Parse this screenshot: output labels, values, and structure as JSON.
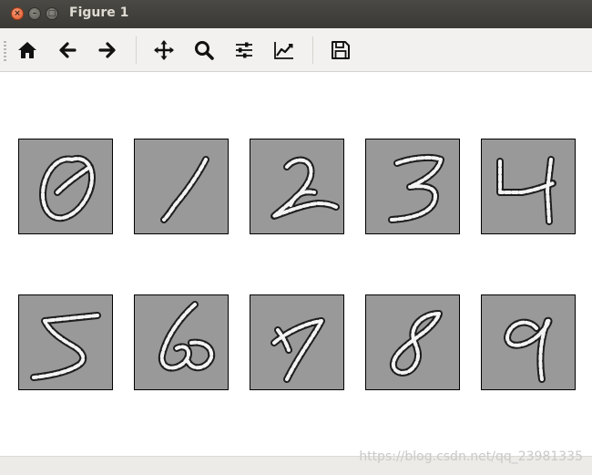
{
  "window": {
    "title": "Figure 1"
  },
  "toolbar": {
    "buttons": [
      {
        "icon": "home-icon",
        "tooltip": "Home"
      },
      {
        "icon": "back-arrow-icon",
        "tooltip": "Back"
      },
      {
        "icon": "forward-arrow-icon",
        "tooltip": "Forward"
      },
      {
        "icon": "pan-move-icon",
        "tooltip": "Pan"
      },
      {
        "icon": "zoom-magnifier-icon",
        "tooltip": "Zoom"
      },
      {
        "icon": "subplots-sliders-icon",
        "tooltip": "Subplots"
      },
      {
        "icon": "edit-axis-chart-icon",
        "tooltip": "Customize"
      },
      {
        "icon": "save-floppy-icon",
        "tooltip": "Save"
      }
    ]
  },
  "figure": {
    "panels": [
      "0",
      "1",
      "2",
      "3",
      "4",
      "5",
      "6",
      "7",
      "8",
      "9"
    ]
  },
  "colors": {
    "panel_background": "#999999",
    "titlebar": "#3d3c38",
    "toolbar": "#f2f1ef"
  },
  "watermark": "https://blog.csdn.net/qq_23981335"
}
